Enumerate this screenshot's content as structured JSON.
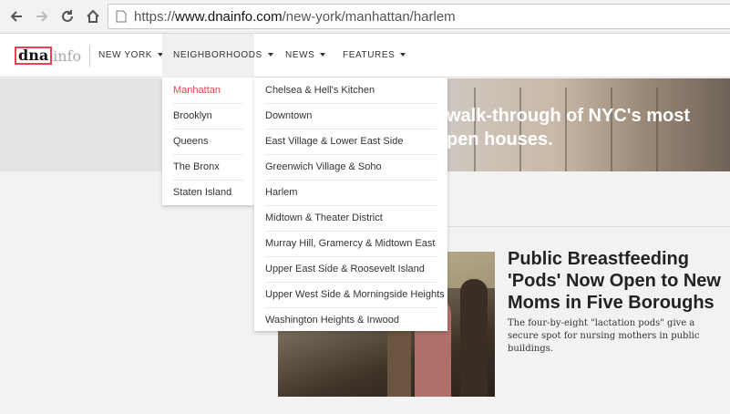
{
  "browser": {
    "url_prefix": "https://",
    "url_domain": "www.dnainfo.com",
    "url_path": "/new-york/manhattan/harlem"
  },
  "header": {
    "logo_dna": "dna",
    "logo_info": "info",
    "nav": [
      {
        "label": "NEW YORK"
      },
      {
        "label": "NEIGHBORHOODS"
      },
      {
        "label": "NEWS"
      },
      {
        "label": "FEATURES"
      }
    ]
  },
  "banner": {
    "line1": "walk-through of NYC's most",
    "line2": "pen houses."
  },
  "boroughs": [
    "Manhattan",
    "Brooklyn",
    "Queens",
    "The Bronx",
    "Staten Island"
  ],
  "neighborhoods": [
    "Chelsea & Hell's Kitchen",
    "Downtown",
    "East Village & Lower East Side",
    "Greenwich Village & Soho",
    "Harlem",
    "Midtown & Theater District",
    "Murray Hill, Gramercy & Midtown East",
    "Upper East Side & Roosevelt Island",
    "Upper West Side & Morningside Heights",
    "Washington Heights & Inwood"
  ],
  "story": {
    "title": "Public Breastfeeding 'Pods' Now Open to New Moms in Five Boroughs",
    "description": "The four-by-eight \"lactation pods\" give a secure spot for nursing mothers in public buildings."
  },
  "colors": {
    "accent": "#e5484d",
    "logo_border": "#e8434e"
  }
}
